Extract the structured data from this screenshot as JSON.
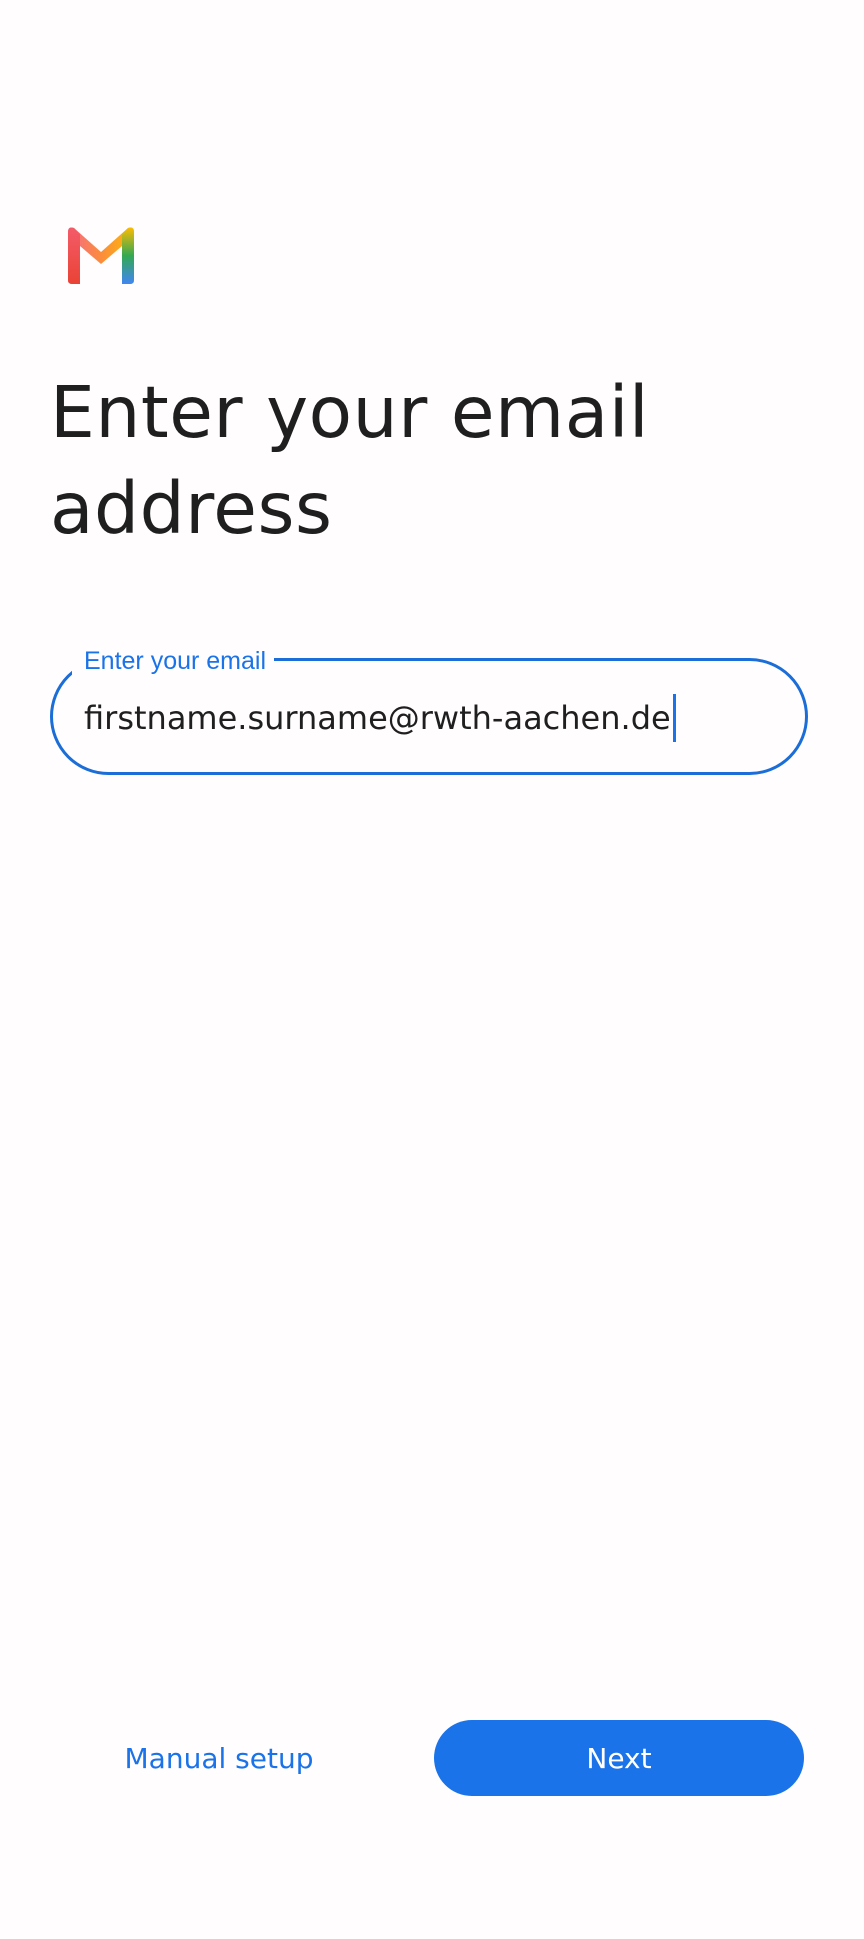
{
  "app": {
    "logo_icon": "gmail-logo-icon",
    "colors": {
      "accent": "#1a73e8",
      "title_text": "#1f1f1f",
      "background": "#fffdfd"
    }
  },
  "page": {
    "title": "Enter your email address"
  },
  "email_field": {
    "label": "Enter your email",
    "value": "firstname.surname@rwth-aachen.de"
  },
  "actions": {
    "manual_setup_label": "Manual setup",
    "next_label": "Next"
  }
}
